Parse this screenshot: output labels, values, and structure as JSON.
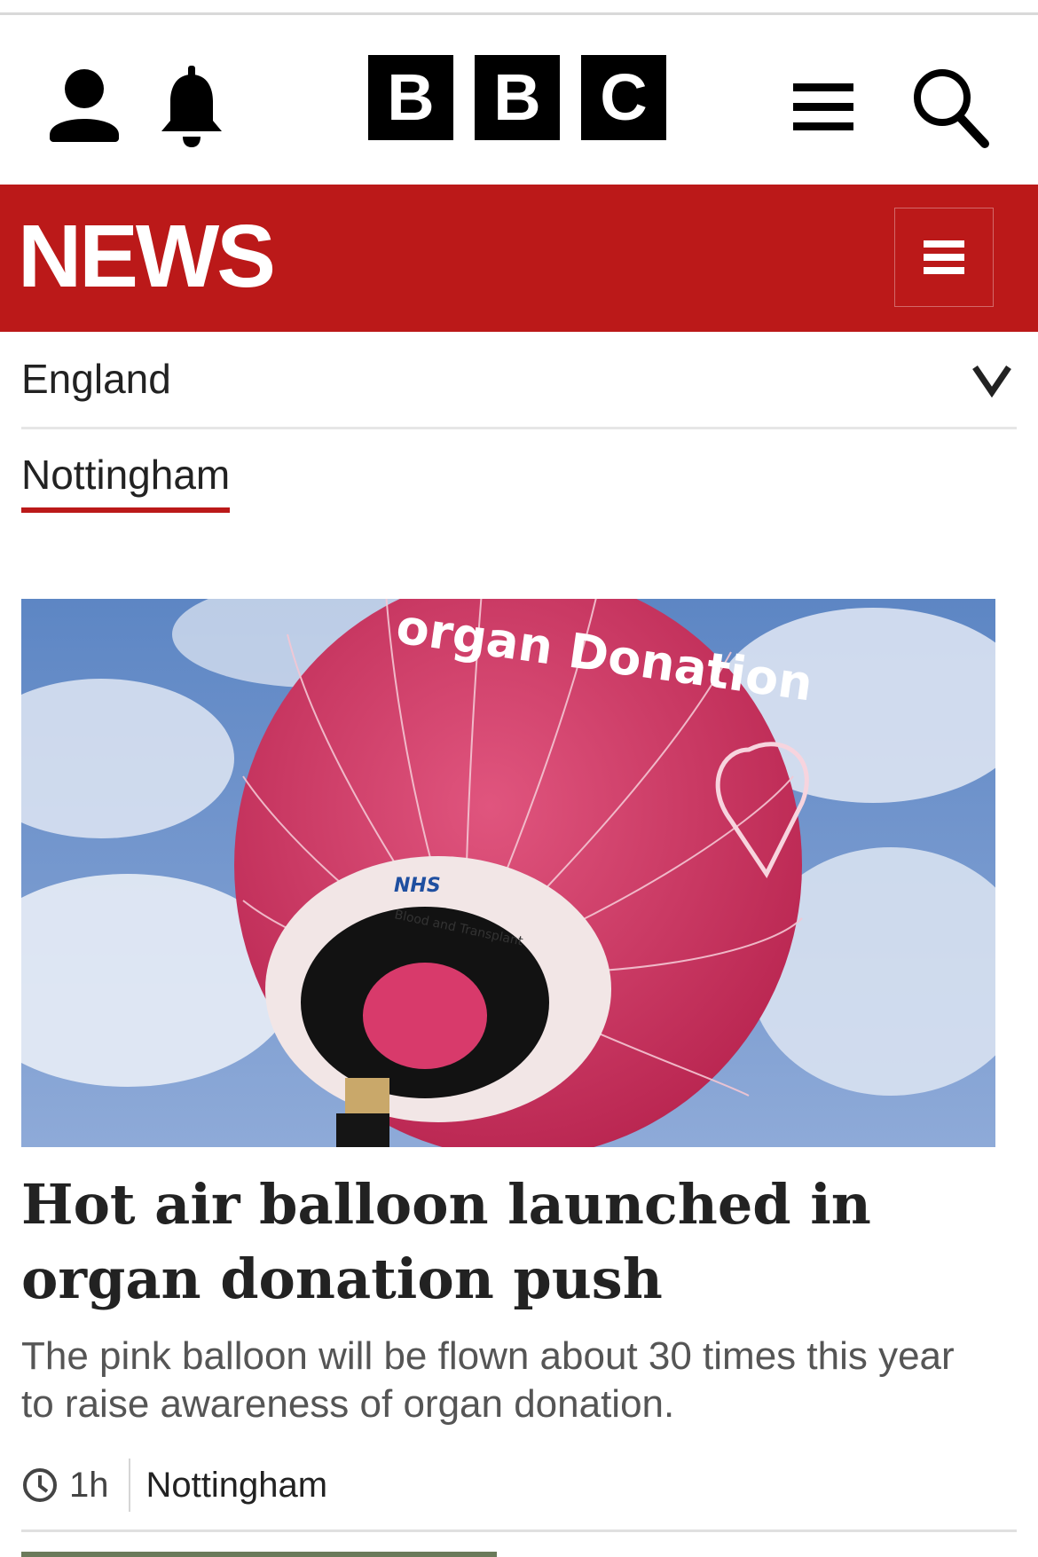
{
  "header": {
    "logo_letters": [
      "B",
      "B",
      "C"
    ],
    "icons": {
      "account": "account-icon",
      "notifications": "bell-icon",
      "menu": "menu-icon",
      "search": "search-icon"
    }
  },
  "news_bar": {
    "title": "NEWS",
    "color": "#bb1919",
    "menu_icon": "menu-icon"
  },
  "nav": {
    "region": "England",
    "region_icon": "chevron-down-icon",
    "selected_tab": "Nottingham",
    "accent": "#bb1919"
  },
  "article": {
    "image_text": "organ Donation",
    "image_logo": "NHS",
    "image_caption_ring": "Blood and Transplant",
    "headline": "Hot air balloon launched in organ donation push",
    "summary": "The pink balloon will be flown about 30 times this year to raise awareness of organ donation.",
    "time": "1h",
    "location": "Nottingham",
    "time_icon": "clock-icon"
  }
}
